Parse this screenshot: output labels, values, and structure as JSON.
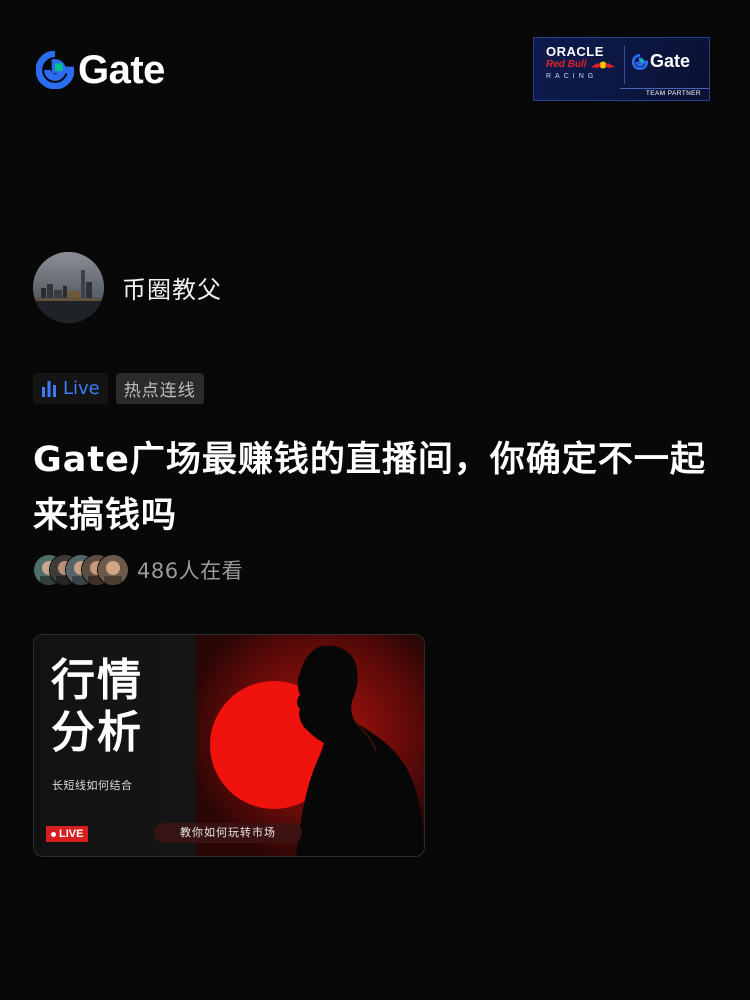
{
  "header": {
    "logo_text": "Gate",
    "brand_color": "#2b6cf0",
    "accent_color": "#00c08b",
    "partner_badge": {
      "oracle": "ORACLE",
      "redbull": "Red Bull",
      "racing": "RACING",
      "gate": "Gate",
      "team_partner": "TEAM PARTNER"
    }
  },
  "author": {
    "name": "币圈教父",
    "avatar_icon": "city-avatar"
  },
  "tags": {
    "live_label": "Live",
    "live_color": "#3b7ef6",
    "topic": "热点连线"
  },
  "post": {
    "title": "Gate广场最赚钱的直播间，你确定不一起来搞钱吗"
  },
  "viewers": {
    "count_text": "486人在看"
  },
  "live_card": {
    "heading_line1": "行情",
    "heading_line2": "分析",
    "subtitle": "长短线如何结合",
    "live_badge": "LIVE",
    "pill_text": "教你如何玩转市场",
    "accent_color": "#e3150f"
  }
}
